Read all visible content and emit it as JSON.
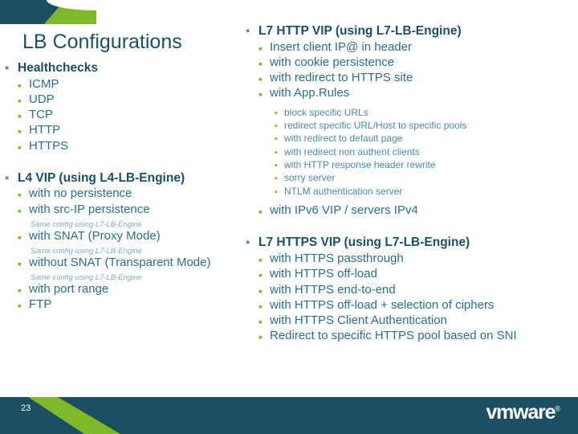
{
  "slide": {
    "title": "LB Configurations",
    "number": "23",
    "brand": "vmware",
    "brand_mark": "®",
    "colors": {
      "primary_dark": "#1d4f63",
      "accent_green": "#7db928",
      "body_text": "#2f6d86",
      "bullet_blue": "#5b8fa8"
    }
  },
  "left_column": {
    "healthchecks": {
      "label": "Healthchecks",
      "items": [
        "ICMP",
        "UDP",
        "TCP",
        "HTTP",
        "HTTPS"
      ]
    },
    "l4vip": {
      "label": "L4 VIP (using L4-LB-Engine)",
      "items": [
        "with no persistence",
        "with src-IP persistence"
      ],
      "note1": "Same config using L7-LB-Engine",
      "item_snat": "with SNAT (Proxy Mode)",
      "note2": "Same config using L7-LB-Engine",
      "item_nosnat": "without SNAT (Transparent Mode)",
      "note3": "Same config using L7-LB-Engine",
      "items_tail": [
        "with port range",
        "FTP"
      ]
    }
  },
  "right_column": {
    "l7http": {
      "label": "L7 HTTP VIP (using L7-LB-Engine)",
      "items": [
        "Insert client IP@ in header",
        "with cookie persistence",
        "with redirect to HTTPS site",
        "with App.Rules"
      ],
      "apprules": [
        "block specific URLs",
        "redirect specific URL/Host to specific pools",
        "with redirect to default page",
        "with redirect non authent clients",
        "with HTTP response header rewrite",
        "sorry server",
        "NTLM authentication server"
      ],
      "item_ipv6": "with IPv6 VIP / servers IPv4"
    },
    "l7https": {
      "label": "L7 HTTPS VIP (using L7-LB-Engine)",
      "items": [
        "with HTTPS passthrough",
        "with HTTPS off-load",
        "with HTTPS end-to-end",
        "with HTTPS off-load + selection of ciphers",
        "with HTTPS Client Authentication",
        "Redirect to specific HTTPS pool based on SNI"
      ]
    }
  }
}
